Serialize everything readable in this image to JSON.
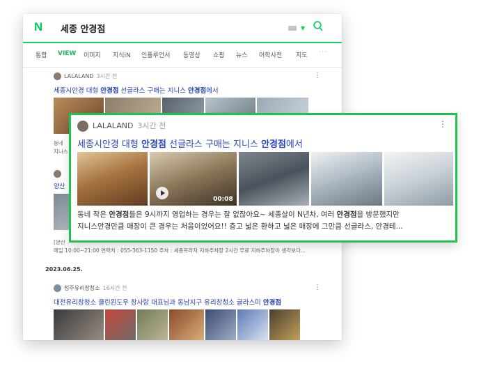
{
  "search": {
    "logo": "N",
    "query": "세종 안경점"
  },
  "tabs": [
    "통합",
    "VIEW",
    "이미지",
    "지식iN",
    "인플루언서",
    "동영상",
    "쇼핑",
    "뉴스",
    "어학사전",
    "지도"
  ],
  "tabs_more": "···",
  "active_tab": "VIEW",
  "posts": [
    {
      "author": "LALALAND",
      "time": "3시간 전",
      "title_parts": [
        {
          "t": "세종시안경 대형 ",
          "b": false
        },
        {
          "t": "안경점",
          "b": true
        },
        {
          "t": " 선글라스 구매는 지니스 ",
          "b": false
        },
        {
          "t": "안경점",
          "b": true
        },
        {
          "t": "에서",
          "b": false
        }
      ],
      "video_duration": "00:08",
      "desc_parts_1": [
        {
          "t": "동네 작은 ",
          "b": false
        },
        {
          "t": "안경점",
          "b": true
        },
        {
          "t": "들은 9시까지 영업하는 경우는 잘 없잖아요~ 세종살이 N년차, 여러 ",
          "b": false
        },
        {
          "t": "안경점",
          "b": true
        },
        {
          "t": "을 방문했지만",
          "b": false
        }
      ],
      "desc_line_2": "지니스안경만큼 매장이 큰 경우는 처음이었어요!! 층고 넓은 환하고 넓은 매장에 그만큼 선글라스, 안경테...",
      "preview_1": "동네",
      "preview_2": "지니스"
    },
    {
      "partial_title": "양산",
      "info_1": "[양산",
      "info_2": "매일 10:00~21:00 연락처 : 055-363-1150 주차 : 세종프라자 지하주차장 2시간 무료 지하주차장이 생각보다..."
    },
    {
      "date": "2023.06.25.",
      "author": "청주유리창청소",
      "time": "16시간 전",
      "title_parts": [
        {
          "t": "대전유리창청소 클린윈도우 창사랑 대표님과 동남지구 유리창청소 글라스미 ",
          "b": false
        },
        {
          "t": "안경점",
          "b": true
        }
      ]
    }
  ],
  "icons": {
    "kebab": "⋮",
    "caret": "▼",
    "search": "search-icon",
    "play": "play-icon",
    "keyboard": "keyboard-icon"
  },
  "colors": {
    "accent": "#03c75a",
    "link": "#2444c3",
    "highlight_border": "#22c24e"
  }
}
